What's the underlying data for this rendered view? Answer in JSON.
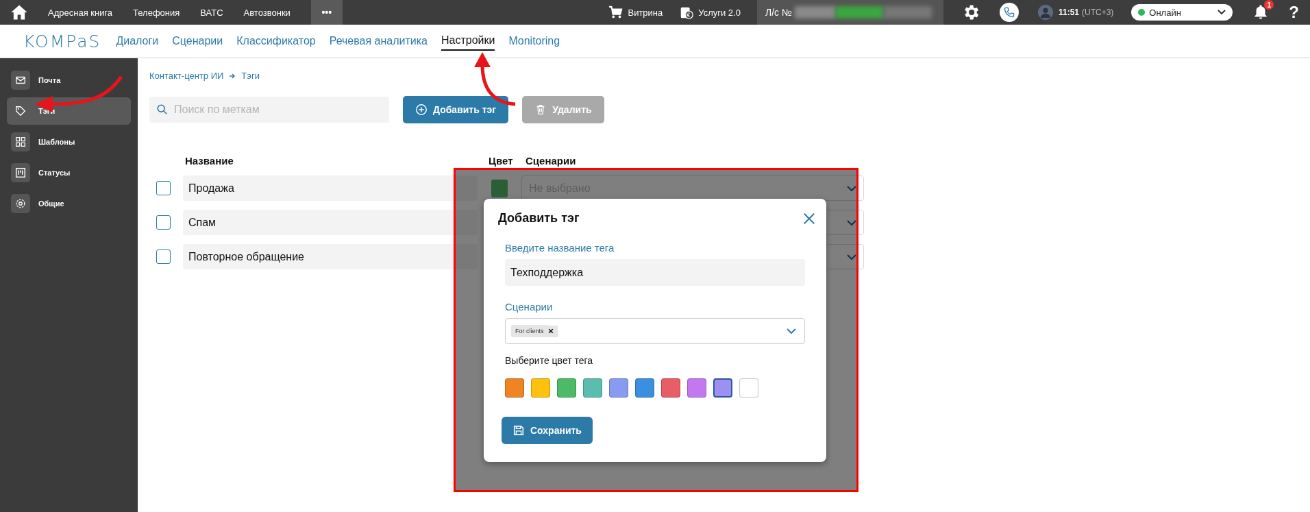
{
  "topbar": {
    "menu": [
      {
        "label": "Адресная книга"
      },
      {
        "label": "Телефония"
      },
      {
        "label": "ВАТС"
      },
      {
        "label": "Автозвонки"
      }
    ],
    "more": "•••",
    "shop": "Витрина",
    "services": "Услуги 2.0",
    "account_label": "Л/с №",
    "time": "11:51",
    "timezone": "(UTC+3)",
    "status": {
      "label": "Онлайн",
      "color": "#2eb85c"
    },
    "notifications": "1",
    "help": "?"
  },
  "nav": {
    "logo": "KOMPaS",
    "links": [
      {
        "label": "Диалоги",
        "selected": false
      },
      {
        "label": "Сценарии",
        "selected": false
      },
      {
        "label": "Классификатор",
        "selected": false
      },
      {
        "label": "Речевая аналитика",
        "selected": false
      },
      {
        "label": "Настройки",
        "selected": true
      },
      {
        "label": "Monitoring",
        "selected": false
      }
    ]
  },
  "sidebar": {
    "items": [
      {
        "label": "Почта",
        "selected": false
      },
      {
        "label": "Тэги",
        "selected": true
      },
      {
        "label": "Шаблоны",
        "selected": false
      },
      {
        "label": "Статусы",
        "selected": false
      },
      {
        "label": "Общие",
        "selected": false
      }
    ]
  },
  "breadcrumb": [
    "Контакт-центр ИИ",
    "Тэги"
  ],
  "search": {
    "placeholder": "Поиск по меткам"
  },
  "buttons": {
    "add": {
      "label": "Добавить тэг",
      "disabled": false
    },
    "delete": {
      "label": "Удалить",
      "disabled": true
    }
  },
  "table": {
    "columns": [
      "Название",
      "Цвет",
      "Сценарии"
    ],
    "rows": [
      {
        "name": "Продажа",
        "checked": false,
        "color": "#2b5e34",
        "scenarios_placeholder": "Не выбрано"
      },
      {
        "name": "Спам",
        "checked": false
      },
      {
        "name": "Повторное обращение",
        "checked": false
      }
    ]
  },
  "modal": {
    "title": "Добавить тэг",
    "name_label": "Введите название тега",
    "name_value": "Техподдержка",
    "scenarios_label": "Сценарии",
    "scenarios": [
      {
        "label": "For clients"
      }
    ],
    "color_label": "Выберите цвет тега",
    "colors": [
      {
        "color": "#ef8423",
        "selected": false
      },
      {
        "color": "#fdc10e",
        "selected": false
      },
      {
        "color": "#4cba66",
        "selected": false
      },
      {
        "color": "#5bbdb0",
        "selected": false
      },
      {
        "color": "#879bf0",
        "selected": false
      },
      {
        "color": "#3a8fe0",
        "selected": false
      },
      {
        "color": "#e85e66",
        "selected": false
      },
      {
        "color": "#c478f0",
        "selected": false
      },
      {
        "color": "#9e90f0",
        "selected": true
      },
      {
        "color": "#ffffff",
        "selected": false
      }
    ],
    "save": "Сохранить"
  }
}
